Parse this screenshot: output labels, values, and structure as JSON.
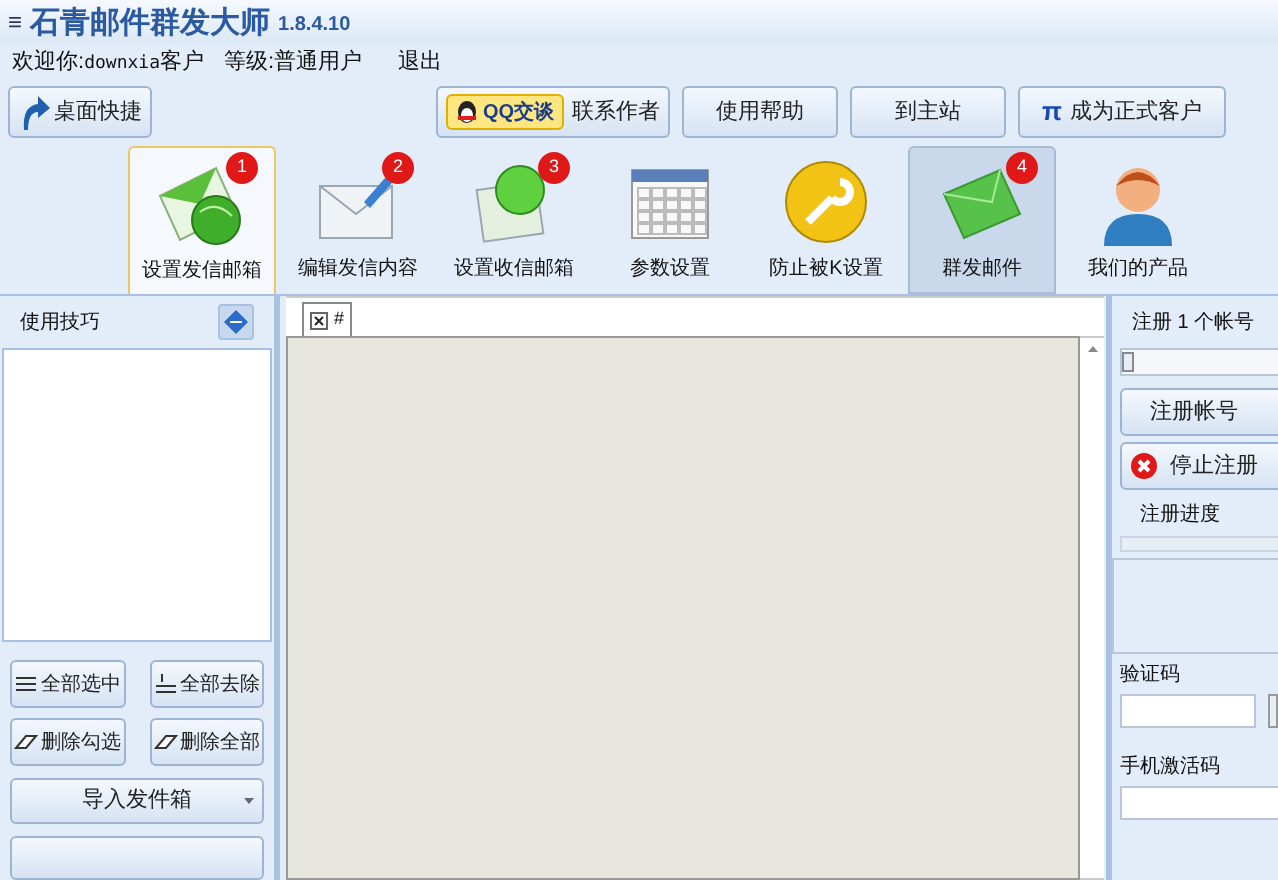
{
  "window": {
    "title": "石青邮件群发大师",
    "version": "1.8.4.10",
    "menu_glyph": "≡"
  },
  "welcome": {
    "greeting": "欢迎你:",
    "user": "downxia",
    "user_suffix": "客户",
    "level_label": "等级:",
    "level": "普通用户",
    "logout": "退出"
  },
  "desktop_shortcut": "桌面快捷",
  "top_buttons": [
    {
      "kind": "qq",
      "label": "QQ交谈",
      "extra": "联系作者"
    },
    {
      "kind": "plain",
      "label": "使用帮助"
    },
    {
      "kind": "plain",
      "label": "到主站"
    },
    {
      "kind": "pi",
      "label": "成为正式客户",
      "glyph": "π"
    }
  ],
  "toolbar": [
    {
      "label": "设置发信邮箱",
      "badge": "1",
      "kind": "mail-globe",
      "selected": true,
      "highlighted": false
    },
    {
      "label": "编辑发信内容",
      "badge": "2",
      "kind": "envelope-pen",
      "selected": false,
      "highlighted": false
    },
    {
      "label": "设置收信邮箱",
      "badge": "3",
      "kind": "globe-card",
      "selected": false,
      "highlighted": false
    },
    {
      "label": "参数设置",
      "kind": "calendar",
      "selected": false,
      "highlighted": false
    },
    {
      "label": "防止被K设置",
      "kind": "wrench",
      "selected": false,
      "highlighted": false
    },
    {
      "label": "群发邮件",
      "badge": "4",
      "kind": "green-envelope",
      "selected": false,
      "highlighted": true
    },
    {
      "label": "我们的产品",
      "kind": "person",
      "selected": false,
      "highlighted": false
    }
  ],
  "left_panel": {
    "title": "使用技巧",
    "buttons": [
      {
        "label": "全部选中",
        "kind": "select"
      },
      {
        "label": "全部去除",
        "kind": "remove"
      },
      {
        "label": "删除勾选",
        "kind": "eraser"
      },
      {
        "label": "删除全部",
        "kind": "eraser"
      }
    ],
    "import": "导入发件箱"
  },
  "editor": {
    "tab": "#"
  },
  "right_panel": {
    "count_label": "注册 1 个帐号",
    "slider": {
      "level": 0
    },
    "register": "注册帐号",
    "stop": "停止注册",
    "progress_label": "注册进度",
    "progress": {
      "level": 0
    },
    "captcha_label": "验证码",
    "phone_label": "手机激活码"
  }
}
